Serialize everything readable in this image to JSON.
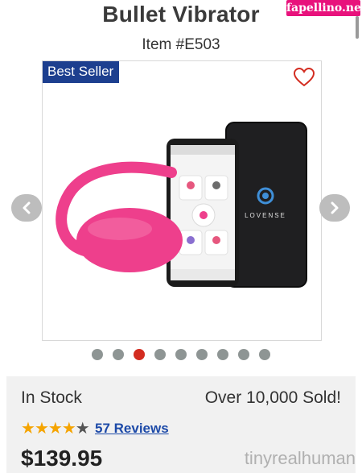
{
  "product": {
    "title": "Bullet Vibrator",
    "item_number": "Item #E503",
    "badge": "Best Seller",
    "phone_brand": "LOVENSE"
  },
  "watermark": {
    "top": "fapellino.net",
    "bottom": "tinyrealhuman"
  },
  "gallery": {
    "dot_count": 9,
    "active_index": 2
  },
  "info": {
    "stock_status": "In Stock",
    "sold_text": "Over 10,000 Sold!",
    "rating": 4,
    "rating_max": 5,
    "reviews_label": "57 Reviews",
    "price": "$139.95"
  },
  "colors": {
    "badge": "#1d3f8f",
    "accent_red": "#d32c20",
    "star": "#f5a400",
    "product_pink": "#ee3f8c"
  }
}
